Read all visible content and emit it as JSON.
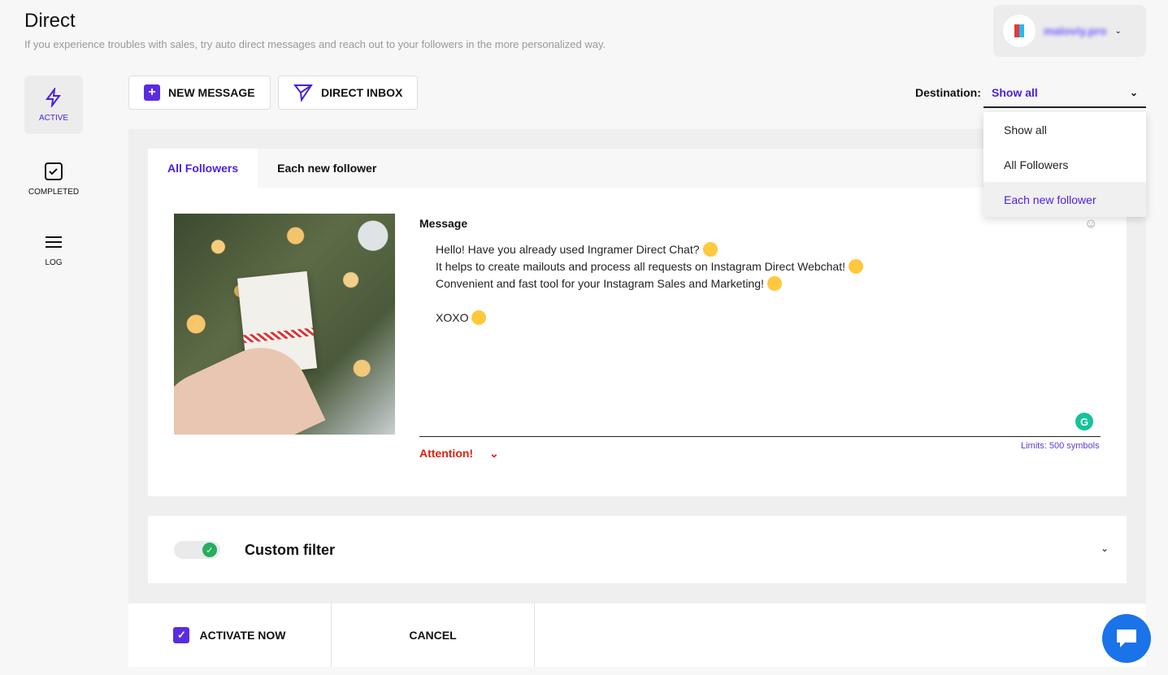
{
  "header": {
    "title": "Direct",
    "subtitle": "If you experience troubles with sales, try auto direct messages and reach out to your followers in the more personalized way.",
    "account_name": "maloviy.pro"
  },
  "sidebar": {
    "items": [
      {
        "label": "ACTIVE",
        "icon": "lightning-icon"
      },
      {
        "label": "COMPLETED",
        "icon": "checkbox-icon"
      },
      {
        "label": "LOG",
        "icon": "menu-icon"
      }
    ]
  },
  "toolbar": {
    "new_message": "NEW MESSAGE",
    "direct_inbox": "DIRECT INBOX",
    "destination_label": "Destination:",
    "destination_value": "Show all"
  },
  "dropdown": {
    "options": [
      "Show all",
      "All Followers",
      "Each new follower"
    ],
    "highlighted": "Each new follower"
  },
  "tabs": [
    "All Followers",
    "Each new follower"
  ],
  "message": {
    "label": "Message",
    "lines": [
      "Hello! Have you already used Ingramer Direct Chat?",
      "It helps to create mailouts and process all requests on Instagram Direct Webchat!",
      "Convenient and fast tool for your Instagram Sales and Marketing!",
      "",
      "XOXO"
    ],
    "limits": "Limits: 500 symbols",
    "attention": "Attention!"
  },
  "filter": {
    "title": "Custom filter",
    "enabled": true
  },
  "footer": {
    "activate": "ACTIVATE NOW",
    "activate_checked": true,
    "cancel": "CANCEL"
  },
  "colors": {
    "accent": "#4a1fdc",
    "attention": "#e0200f",
    "toggle_on": "#27ae60",
    "chat": "#1a73e8"
  }
}
